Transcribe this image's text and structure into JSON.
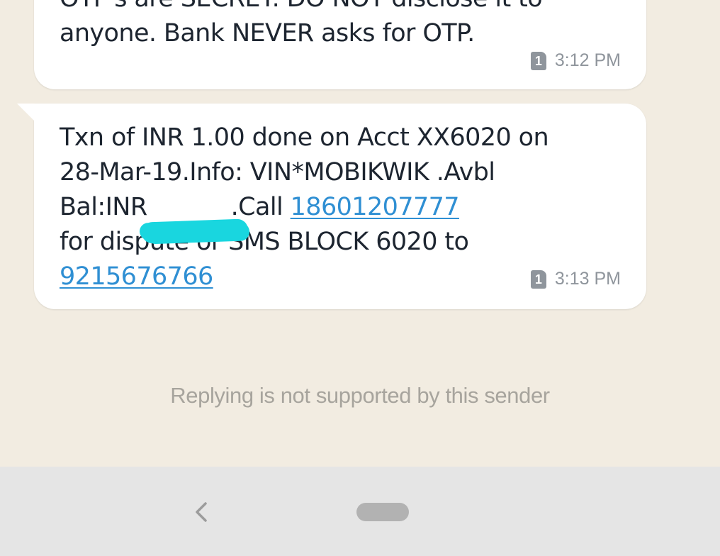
{
  "messages": [
    {
      "text_line_partial": "OTP's are SECRET. DO NOT disclose it to",
      "text_line": "anyone. Bank NEVER asks for OTP.",
      "sim_slot": "1",
      "time": "3:12 PM"
    },
    {
      "text_part1": "Txn of INR 1.00 done on Acct XX6020 on\n28-Mar-19.Info: VIN*MOBIKWIK .Avbl\nBal:INR",
      "text_part2": ".Call ",
      "link_phone_1": "18601207777",
      "text_part3": "\nfor dispute or SMS BLOCK 6020 to\n",
      "link_phone_2": "9215676766",
      "sim_slot": "1",
      "time": "3:13 PM"
    }
  ],
  "reply_notice": "Replying is not supported by this sender",
  "navigation": {
    "back_icon": "chevron-left-icon",
    "home_icon": "home-pill-icon"
  },
  "colors": {
    "chat_background": "#f2ece1",
    "bubble": "#ffffff",
    "link": "#2f8fd3",
    "redaction": "#19d6df",
    "nav_bar": "#e5e5e5"
  }
}
